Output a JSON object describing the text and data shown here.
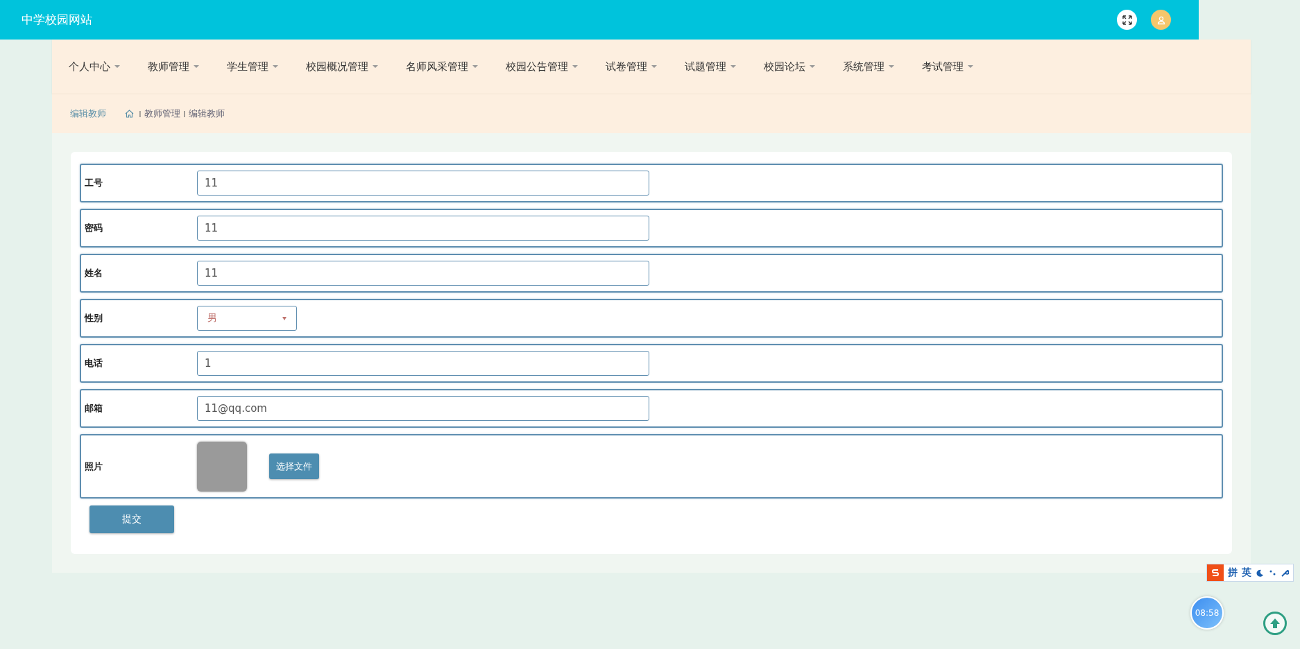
{
  "header": {
    "title": "中学校园网站"
  },
  "nav": [
    {
      "label": "个人中心"
    },
    {
      "label": "教师管理"
    },
    {
      "label": "学生管理"
    },
    {
      "label": "校园概况管理"
    },
    {
      "label": "名师风采管理"
    },
    {
      "label": "校园公告管理"
    },
    {
      "label": "试卷管理"
    },
    {
      "label": "试题管理"
    },
    {
      "label": "校园论坛"
    },
    {
      "label": "系统管理"
    },
    {
      "label": "考试管理"
    }
  ],
  "breadcrumb": {
    "title": "编辑教师",
    "path": [
      {
        "separator": "I",
        "label": "教师管理"
      },
      {
        "separator": "I",
        "label": "编辑教师"
      }
    ]
  },
  "form": {
    "fields": [
      {
        "kind": "text",
        "label": "工号",
        "value": "11"
      },
      {
        "kind": "text",
        "label": "密码",
        "value": "11"
      },
      {
        "kind": "text",
        "label": "姓名",
        "value": "11"
      },
      {
        "kind": "select",
        "label": "性别",
        "value": "男"
      },
      {
        "kind": "text",
        "label": "电话",
        "value": "1"
      },
      {
        "kind": "text",
        "label": "邮箱",
        "value": "11@qq.com"
      },
      {
        "kind": "image",
        "label": "照片",
        "button": "选择文件"
      }
    ],
    "submit": "提交"
  },
  "ime_bar": {
    "items": [
      "拼",
      "英"
    ]
  },
  "clock": "08:58"
}
